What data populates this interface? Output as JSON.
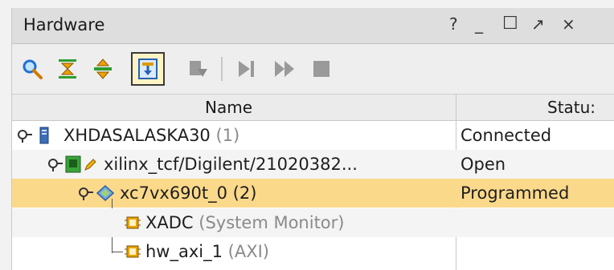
{
  "window": {
    "title": "Hardware",
    "controls": {
      "help": "?",
      "minimize": "_",
      "maximize": "☐",
      "float": "↗",
      "close": "×"
    }
  },
  "toolbar": {
    "buttons": [
      {
        "icon": "search-icon"
      },
      {
        "icon": "collapse-all-icon"
      },
      {
        "icon": "expand-all-icon"
      },
      {
        "icon": "auto-connect-icon",
        "active": true
      },
      {
        "icon": "program-device-icon",
        "enabled": false
      },
      {
        "icon": "run-trigger-icon",
        "enabled": false
      },
      {
        "icon": "run-trigger-immediate-icon",
        "enabled": false
      },
      {
        "icon": "stop-trigger-icon",
        "enabled": false
      }
    ]
  },
  "table": {
    "columns": {
      "name": "Name",
      "status": "Statu:"
    },
    "rows": [
      {
        "name": "XHDASALASKA30",
        "count": "(1)",
        "status": "Connected"
      },
      {
        "name": "xilinx_tcf/Digilent/21020382...",
        "status": "Open"
      },
      {
        "name": "xc7vx690t_0 (2)",
        "status": "Programmed",
        "selected": true
      },
      {
        "name": "XADC",
        "type": "(System Monitor)",
        "status": ""
      },
      {
        "name": "hw_axi_1",
        "type": "(AXI)",
        "status": ""
      }
    ]
  },
  "colors": {
    "selection": "#fbd98a",
    "accent": "#e8a200"
  }
}
